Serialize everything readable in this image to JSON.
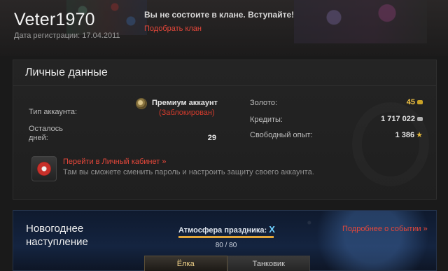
{
  "header": {
    "username": "Veter1970",
    "reg_date": "Дата регистрации: 17.04.2011",
    "clan_message": "Вы не состоите в клане. Вступайте!",
    "clan_link": "Подобрать клан"
  },
  "personal": {
    "title": "Личные данные",
    "account_type_label": "Тип аккаунта:",
    "account_type_value": "Премиум аккаунт",
    "account_status": "(Заблокирован)",
    "days_left_label": "Осталось дней:",
    "days_left_value": "29",
    "gold_label": "Золото:",
    "gold_value": "45",
    "credits_label": "Кредиты:",
    "credits_value": "1 717 022",
    "free_xp_label": "Свободный опыт:",
    "free_xp_value": "1 386",
    "cabinet_link": "Перейти в Личный кабинет »",
    "cabinet_desc": "Там вы сможете сменить пароль и настроить защиту своего аккаунта."
  },
  "event": {
    "title": "Новогоднее наступление",
    "atmosphere_label": "Атмосфера праздника:",
    "atmosphere_level": "X",
    "progress_text": "80 / 80",
    "progress_fraction": 1.0,
    "more_link": "Подробнее о событии »",
    "tabs": [
      {
        "label": "Ёлка",
        "active": true
      },
      {
        "label": "Танковик",
        "active": false
      }
    ]
  },
  "colors": {
    "accent_link": "#e5473a",
    "gold": "#f0c245",
    "progress_fill": "#e4a638"
  }
}
